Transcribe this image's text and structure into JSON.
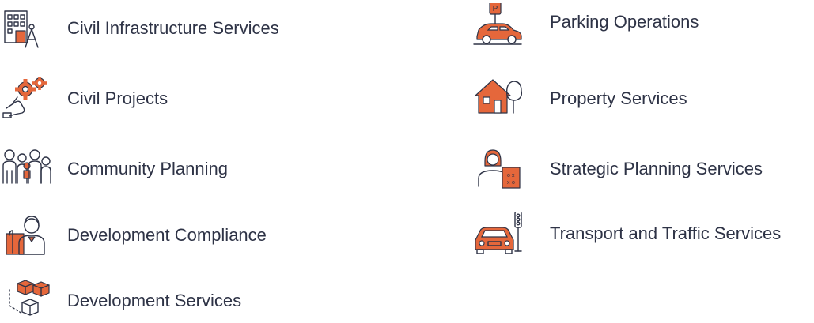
{
  "accent_color": "#e5673b",
  "line_color": "#2e3346",
  "services": {
    "left": [
      {
        "label": "Civil Infrastructure Services",
        "icon": "building-compass-icon"
      },
      {
        "label": "Civil Projects",
        "icon": "hand-gears-icon"
      },
      {
        "label": "Community Planning",
        "icon": "family-group-icon"
      },
      {
        "label": "Development Compliance",
        "icon": "person-document-icon"
      },
      {
        "label": "Development Services",
        "icon": "building-blocks-icon"
      }
    ],
    "right": [
      {
        "label": "Parking Operations",
        "icon": "car-parking-sign-icon"
      },
      {
        "label": "Property Services",
        "icon": "house-tree-icon"
      },
      {
        "label": "Strategic Planning Services",
        "icon": "planner-strategy-board-icon"
      },
      {
        "label": "Transport and Traffic Services",
        "icon": "car-traffic-light-icon"
      }
    ]
  }
}
